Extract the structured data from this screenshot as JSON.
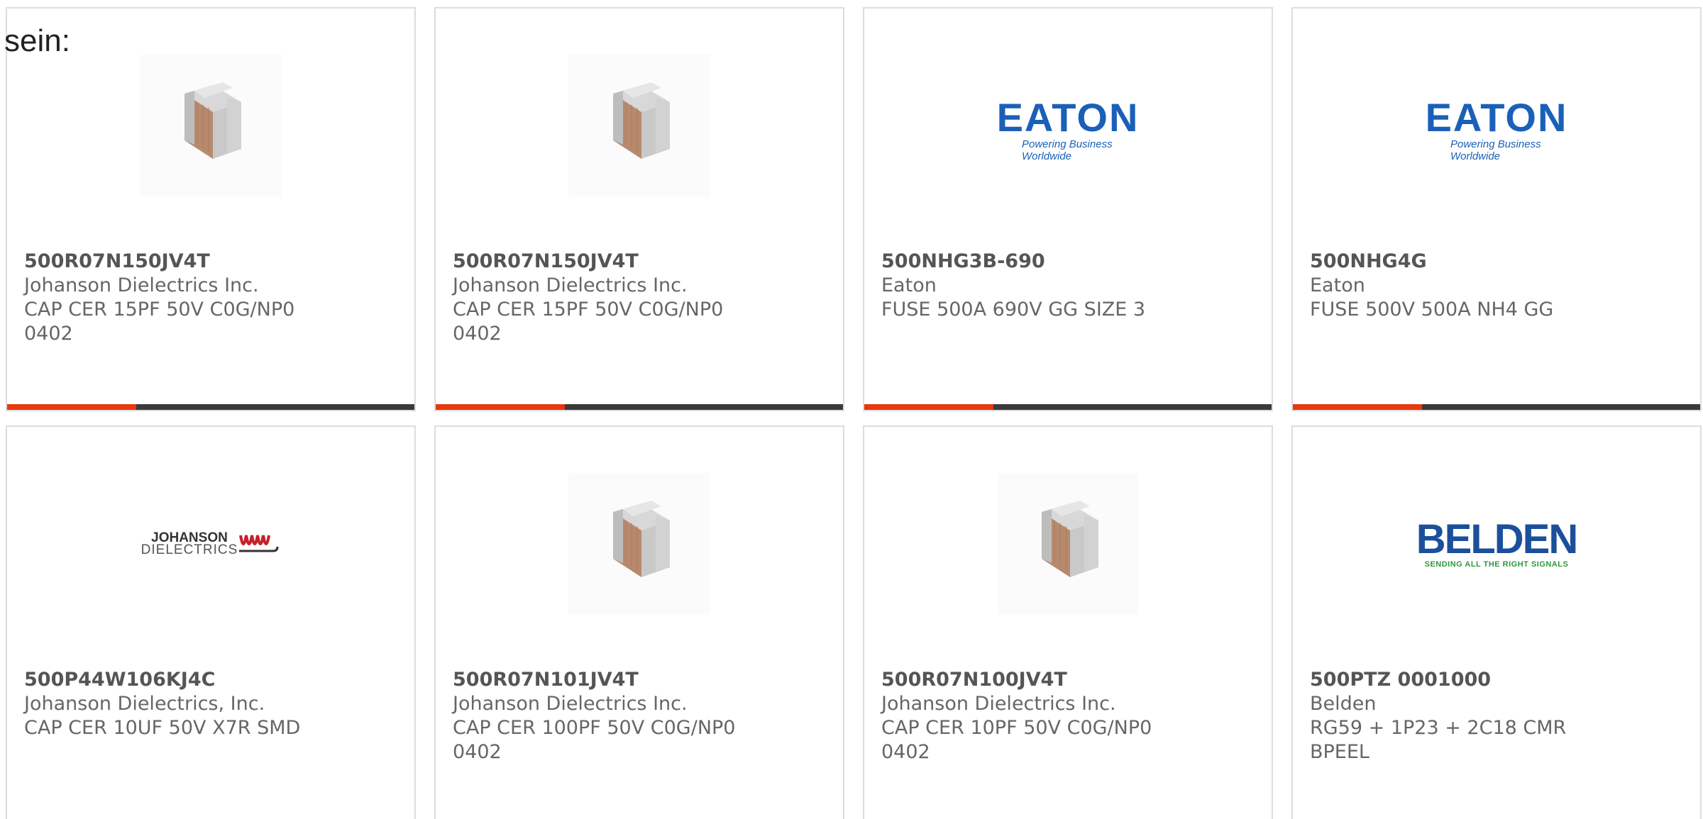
{
  "intro_text": "sein:",
  "colors": {
    "accent_bar": "#e8380d",
    "bar_dark": "#3a3a3a",
    "eaton_blue": "#1a60b8",
    "belden_blue": "#1b4f9b",
    "belden_green": "#2e9a3f"
  },
  "products": [
    {
      "part_number": "500R07N150JV4T",
      "manufacturer": "Johanson Dielectrics Inc.",
      "desc_line1": "CAP CER 15PF 50V C0G/NP0",
      "desc_line2": "0402",
      "image": "capacitor-chip-image"
    },
    {
      "part_number": "500R07N150JV4T",
      "manufacturer": "Johanson Dielectrics Inc.",
      "desc_line1": "CAP CER 15PF 50V C0G/NP0",
      "desc_line2": "0402",
      "image": "capacitor-chip-image"
    },
    {
      "part_number": "500NHG3B-690",
      "manufacturer": "Eaton",
      "desc_line1": "FUSE 500A 690V GG SIZE 3",
      "desc_line2": "",
      "image": "eaton-logo",
      "logo_text": "EATON",
      "logo_tagline": "Powering Business Worldwide"
    },
    {
      "part_number": "500NHG4G",
      "manufacturer": "Eaton",
      "desc_line1": "FUSE 500V 500A NH4 GG",
      "desc_line2": "",
      "image": "eaton-logo",
      "logo_text": "EATON",
      "logo_tagline": "Powering Business Worldwide"
    },
    {
      "part_number": "500P44W106KJ4C",
      "manufacturer": "Johanson Dielectrics, Inc.",
      "desc_line1": "CAP CER 10UF 50V X7R SMD",
      "desc_line2": "",
      "image": "johanson-logo",
      "logo_text": "JOHANSON",
      "logo_tagline": "DIELECTRICS"
    },
    {
      "part_number": "500R07N101JV4T",
      "manufacturer": "Johanson Dielectrics Inc.",
      "desc_line1": "CAP CER 100PF 50V C0G/NP0",
      "desc_line2": "0402",
      "image": "capacitor-chip-image"
    },
    {
      "part_number": "500R07N100JV4T",
      "manufacturer": "Johanson Dielectrics Inc.",
      "desc_line1": "CAP CER 10PF 50V C0G/NP0",
      "desc_line2": "0402",
      "image": "capacitor-chip-image"
    },
    {
      "part_number": "500PTZ 0001000",
      "manufacturer": "Belden",
      "desc_line1": "RG59 + 1P23 + 2C18 CMR BPEEL",
      "desc_line2": "",
      "image": "belden-logo",
      "logo_text": "BELDEN",
      "logo_tagline": "SENDING ALL THE RIGHT SIGNALS"
    }
  ]
}
